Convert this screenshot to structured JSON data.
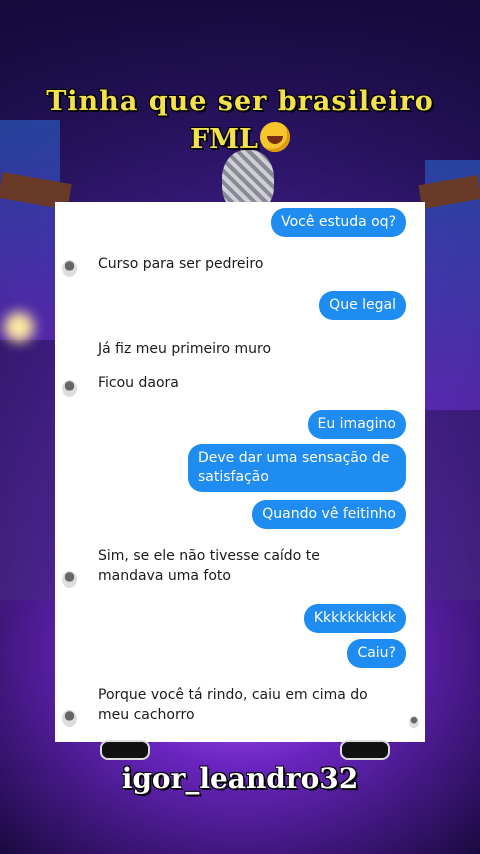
{
  "caption": {
    "line1": "Tinha  que  ser  brasileiro",
    "line2": "FML",
    "emoji_icon": "rolling-on-floor-laughing-emoji"
  },
  "watermark": "igor_leandro32",
  "chat": {
    "messages": [
      {
        "side": "out",
        "text": "Você estuda oq?"
      },
      {
        "side": "in",
        "text": "Curso para ser pedreiro",
        "avatar": true
      },
      {
        "side": "out",
        "text": "Que legal"
      },
      {
        "side": "in",
        "text": "Já fiz meu primeiro muro",
        "avatar": false
      },
      {
        "side": "in",
        "text": "Ficou daora",
        "avatar": true
      },
      {
        "side": "out",
        "text": "Eu imagino"
      },
      {
        "side": "out",
        "text": "Deve dar uma sensação  de satisfação"
      },
      {
        "side": "out",
        "text": "Quando vê feitinho"
      },
      {
        "side": "in",
        "text": "Sim, se ele não tivesse caído te mandava uma foto",
        "avatar": true
      },
      {
        "side": "out",
        "text": "Kkkkkkkkkk"
      },
      {
        "side": "out",
        "text": "Caiu?"
      },
      {
        "side": "in",
        "text": "Porque você tá rindo, caiu em cima do meu cachorro",
        "avatar": true
      }
    ]
  },
  "colors": {
    "bubble_out": "#1e8cf0",
    "caption": "#f4e24a"
  }
}
